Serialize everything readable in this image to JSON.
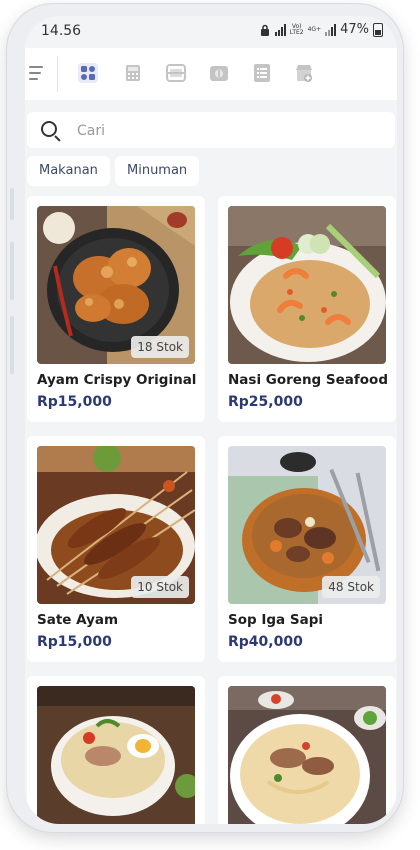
{
  "status_bar": {
    "time": "14.56",
    "network_top": "Vo)",
    "network_bottom": "LTE2",
    "gen_top": "4G+",
    "battery": "47%"
  },
  "toolbar": {
    "icons": [
      "menu-icon",
      "all-categories-icon",
      "pos-icon",
      "scanner-icon",
      "finance-icon",
      "list-icon",
      "store-icon"
    ],
    "accent": "#5a6ab8",
    "inactive": "#bdbdbd"
  },
  "search": {
    "placeholder": "Cari",
    "value": ""
  },
  "categories": [
    "Makanan",
    "Minuman"
  ],
  "products": [
    {
      "name": "Ayam Crispy Original",
      "price": "Rp15,000",
      "stock": "18 Stok"
    },
    {
      "name": "Nasi Goreng Seafood",
      "price": "Rp25,000",
      "stock": ""
    },
    {
      "name": "Sate Ayam",
      "price": "Rp15,000",
      "stock": "10 Stok"
    },
    {
      "name": "Sop Iga Sapi",
      "price": "Rp40,000",
      "stock": "48 Stok"
    },
    {
      "name": "",
      "price": "",
      "stock": ""
    },
    {
      "name": "",
      "price": "",
      "stock": ""
    }
  ],
  "colors": {
    "price": "#2c3a72",
    "chip_text": "#3b4a6b",
    "background": "#f3f4f6"
  }
}
